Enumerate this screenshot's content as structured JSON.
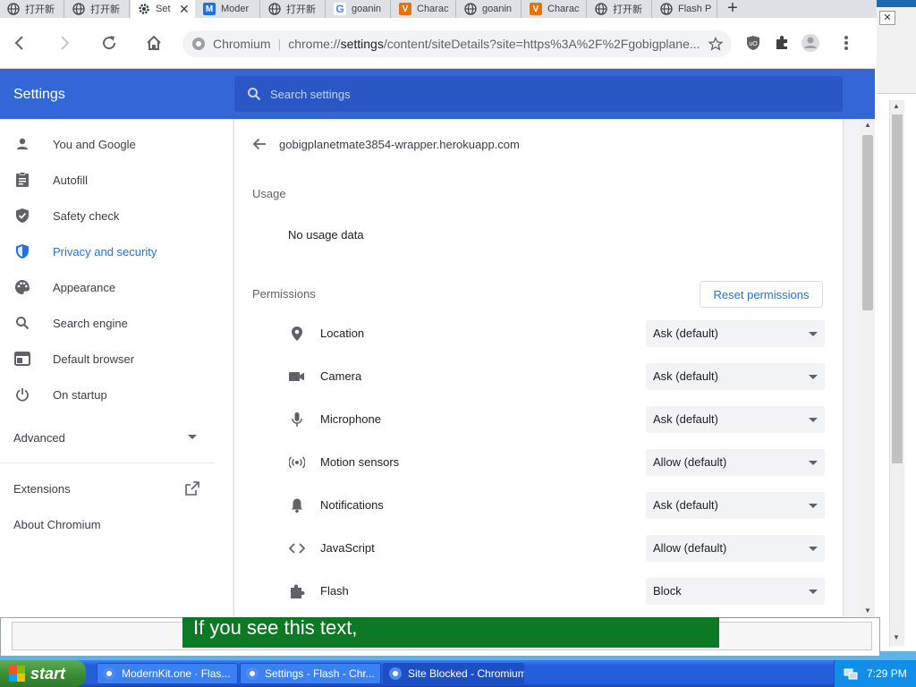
{
  "tabs": [
    {
      "label": "打开新",
      "icon": "globe-icon"
    },
    {
      "label": "打开新",
      "icon": "globe-icon"
    },
    {
      "label": "Set",
      "icon": "gear-icon",
      "active": true
    },
    {
      "label": "Moder",
      "icon": "m-logo-icon"
    },
    {
      "label": "打开新",
      "icon": "globe-icon"
    },
    {
      "label": "goanin",
      "icon": "google-icon"
    },
    {
      "label": "Charac",
      "icon": "v-logo-icon"
    },
    {
      "label": "goanin",
      "icon": "globe-icon"
    },
    {
      "label": "Charac",
      "icon": "v-logo-icon"
    },
    {
      "label": "打开新",
      "icon": "globe-icon"
    },
    {
      "label": "Flash P",
      "icon": "globe-icon"
    }
  ],
  "omnibox": {
    "site": "Chromium",
    "url_path_prefix": "chrome://",
    "url_bold": "settings",
    "url_rest": "/content/siteDetails?site=https%3A%2F%2Fgobigplane..."
  },
  "settings": {
    "title": "Settings",
    "search_placeholder": "Search settings",
    "nav": [
      {
        "label": "You and Google",
        "icon": "person-icon"
      },
      {
        "label": "Autofill",
        "icon": "clipboard-icon"
      },
      {
        "label": "Safety check",
        "icon": "shield-check-icon"
      },
      {
        "label": "Privacy and security",
        "icon": "shield-icon",
        "selected": true
      },
      {
        "label": "Appearance",
        "icon": "palette-icon"
      },
      {
        "label": "Search engine",
        "icon": "search-icon"
      },
      {
        "label": "Default browser",
        "icon": "browser-icon"
      },
      {
        "label": "On startup",
        "icon": "power-icon"
      }
    ],
    "advanced_label": "Advanced",
    "extensions_label": "Extensions",
    "about_label": "About Chromium"
  },
  "site": {
    "name": "gobigplanetmate3854-wrapper.herokuapp.com",
    "usage_title": "Usage",
    "usage_value": "No usage data",
    "permissions_title": "Permissions",
    "reset_label": "Reset permissions",
    "permissions": [
      {
        "label": "Location",
        "value": "Ask (default)",
        "icon": "location-pin-icon"
      },
      {
        "label": "Camera",
        "value": "Ask (default)",
        "icon": "camera-icon"
      },
      {
        "label": "Microphone",
        "value": "Ask (default)",
        "icon": "microphone-icon"
      },
      {
        "label": "Motion sensors",
        "value": "Allow (default)",
        "icon": "sensors-icon"
      },
      {
        "label": "Notifications",
        "value": "Ask (default)",
        "icon": "bell-icon"
      },
      {
        "label": "JavaScript",
        "value": "Allow (default)",
        "icon": "code-icon"
      },
      {
        "label": "Flash",
        "value": "Block",
        "icon": "puzzle-icon"
      }
    ]
  },
  "background": {
    "banner_text": "If you see this text,"
  },
  "taskbar": {
    "start_label": "start",
    "buttons": [
      {
        "label": "ModernKit.one · Flas..."
      },
      {
        "label": "Settings - Flash - Chr..."
      },
      {
        "label": "Site Blocked - Chromium",
        "active": true
      }
    ],
    "clock": "7:29 PM"
  },
  "colors": {
    "accent": "#1a73e8",
    "header_blue": "#3367d6",
    "search_blue": "#2a56c6",
    "taskbar_blue": "#245edb",
    "start_green": "#3c8f36",
    "banner_green": "#0c7a24"
  }
}
